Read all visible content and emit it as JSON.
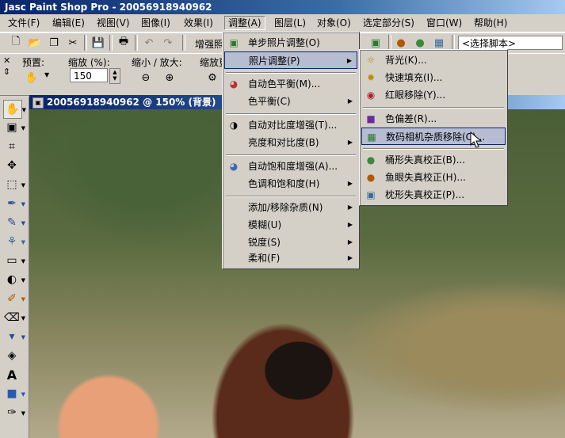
{
  "window": {
    "title": "Jasc Paint Shop Pro - 20056918940962"
  },
  "menubar": [
    {
      "label": "文件(F)"
    },
    {
      "label": "编辑(E)"
    },
    {
      "label": "视图(V)"
    },
    {
      "label": "图像(I)"
    },
    {
      "label": "效果(I)"
    },
    {
      "label": "调整(A)"
    },
    {
      "label": "图层(L)"
    },
    {
      "label": "对象(O)"
    },
    {
      "label": "选定部分(S)"
    },
    {
      "label": "窗口(W)"
    },
    {
      "label": "帮助(H)"
    }
  ],
  "toolbar": {
    "enhance_label": "增强照",
    "script_select": "<选择脚本>"
  },
  "tool_options": {
    "preset_label": "预置:",
    "zoom_label": "缩放 (%):",
    "zoom_value": "150",
    "zoom_inout_label": "缩小 / 放大:",
    "zoom_more_label": "缩放更"
  },
  "image_window": {
    "title": "20056918940962 @ 150% (背景)"
  },
  "adjust_menu": {
    "items": [
      {
        "label": "单步照片调整(O)",
        "icon": "photo-icon",
        "submenu": false
      },
      {
        "label": "照片调整(P)",
        "icon": "",
        "submenu": true
      },
      {
        "label": "自动色平衡(M)...",
        "icon": "color-balance-icon",
        "submenu": false
      },
      {
        "label": "色平衡(C)",
        "icon": "",
        "submenu": true
      },
      {
        "label": "自动对比度增强(T)...",
        "icon": "contrast-icon",
        "submenu": false
      },
      {
        "label": "亮度和对比度(B)",
        "icon": "",
        "submenu": true
      },
      {
        "label": "自动饱和度增强(A)...",
        "icon": "saturation-icon",
        "submenu": false
      },
      {
        "label": "色调和饱和度(H)",
        "icon": "",
        "submenu": true
      },
      {
        "label": "添加/移除杂质(N)",
        "icon": "",
        "submenu": true
      },
      {
        "label": "模糊(U)",
        "icon": "",
        "submenu": true
      },
      {
        "label": "锐度(S)",
        "icon": "",
        "submenu": true
      },
      {
        "label": "柔和(F)",
        "icon": "",
        "submenu": true
      }
    ]
  },
  "photo_submenu": {
    "items": [
      {
        "label": "背光(K)...",
        "icon": "backlight-icon"
      },
      {
        "label": "快速填充(I)...",
        "icon": "fill-flash-icon"
      },
      {
        "label": "红眼移除(Y)...",
        "icon": "red-eye-icon"
      },
      {
        "label": "色偏差(R)...",
        "icon": "color-cast-icon"
      },
      {
        "label": "数码相机杂质移除(C)...",
        "icon": "camera-noise-icon"
      },
      {
        "label": "桶形失真校正(B)...",
        "icon": "barrel-icon"
      },
      {
        "label": "鱼眼失真校正(H)...",
        "icon": "fisheye-icon"
      },
      {
        "label": "枕形失真校正(P)...",
        "icon": "pincushion-icon"
      }
    ]
  }
}
